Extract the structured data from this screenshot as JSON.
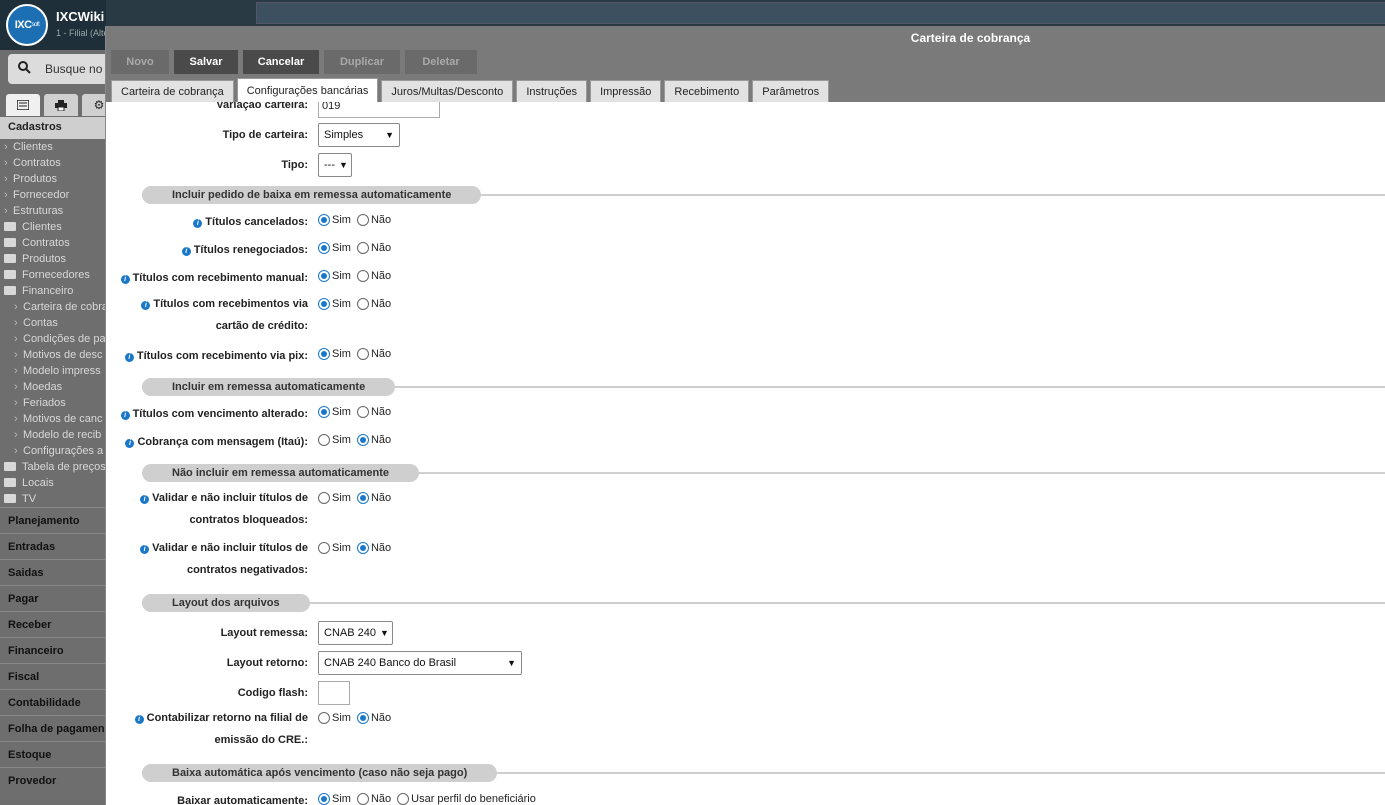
{
  "app": {
    "name": "IXCWiki",
    "subtitle": "1 - Filial (Alte",
    "logo_text": "IXC",
    "logo_sub": "soft"
  },
  "sidebar": {
    "search_placeholder": "Busque no",
    "header": "Cadastros",
    "items": [
      {
        "label": "Clientes",
        "kind": "link"
      },
      {
        "label": "Contratos",
        "kind": "link"
      },
      {
        "label": "Produtos",
        "kind": "link"
      },
      {
        "label": "Fornecedor",
        "kind": "link"
      },
      {
        "label": "Estruturas",
        "kind": "link"
      },
      {
        "label": "Clientes",
        "kind": "folder"
      },
      {
        "label": "Contratos",
        "kind": "folder"
      },
      {
        "label": "Produtos",
        "kind": "folder"
      },
      {
        "label": "Fornecedores",
        "kind": "folder"
      },
      {
        "label": "Financeiro",
        "kind": "folder-open"
      },
      {
        "label": "Carteira de cobra",
        "kind": "sub"
      },
      {
        "label": "Contas",
        "kind": "sub"
      },
      {
        "label": "Condições de pa",
        "kind": "sub"
      },
      {
        "label": "Motivos de desc",
        "kind": "sub"
      },
      {
        "label": "Modelo impress",
        "kind": "sub"
      },
      {
        "label": "Moedas",
        "kind": "sub"
      },
      {
        "label": "Feriados",
        "kind": "sub"
      },
      {
        "label": "Motivos de canc",
        "kind": "sub"
      },
      {
        "label": "Modelo de recib",
        "kind": "sub"
      },
      {
        "label": "Configurações a",
        "kind": "sub"
      },
      {
        "label": "Tabela de preços",
        "kind": "folder"
      },
      {
        "label": "Locais",
        "kind": "folder"
      },
      {
        "label": "TV",
        "kind": "folder"
      }
    ],
    "sections": [
      "Planejamento",
      "Entradas",
      "Saidas",
      "Pagar",
      "Receber",
      "Financeiro",
      "Fiscal",
      "Contabilidade",
      "Folha de pagamen",
      "Estoque",
      "Provedor"
    ]
  },
  "modal": {
    "title": "Carteira de cobrança",
    "toolbar": [
      {
        "label": "Novo",
        "enabled": false
      },
      {
        "label": "Salvar",
        "enabled": true
      },
      {
        "label": "Cancelar",
        "enabled": true
      },
      {
        "label": "Duplicar",
        "enabled": false
      },
      {
        "label": "Deletar",
        "enabled": false
      }
    ],
    "tabs": [
      "Carteira de cobrança",
      "Configurações bancárias",
      "Juros/Multas/Desconto",
      "Instruções",
      "Impressão",
      "Recebimento",
      "Parâmetros"
    ],
    "active_tab": 1
  },
  "form": {
    "variacao": {
      "label": "Variação carteira:",
      "value": "019"
    },
    "tipo_carteira": {
      "label": "Tipo de carteira:",
      "value": "Simples"
    },
    "tipo": {
      "label": "Tipo:",
      "value": "---"
    },
    "sim": "Sim",
    "nao": "Não",
    "sections": {
      "baixa": "Incluir pedido de baixa em remessa automaticamente",
      "incluir": "Incluir em remessa automaticamente",
      "nao_incluir": "Não incluir em remessa automaticamente",
      "layout": "Layout dos arquivos",
      "baixa_auto": "Baixa automática após vencimento (caso não seja pago)"
    },
    "radios": {
      "cancelados": {
        "label": "Títulos cancelados:",
        "value": "Sim"
      },
      "renegociados": {
        "label": "Títulos renegociados:",
        "value": "Sim"
      },
      "manual": {
        "label": "Títulos com recebimento manual:",
        "value": "Sim"
      },
      "cartao_l1": "Títulos com recebimentos via",
      "cartao_l2": "cartão de crédito:",
      "cartao_value": "Sim",
      "pix": {
        "label": "Títulos com recebimento via pix:",
        "value": "Sim"
      },
      "vencimento": {
        "label": "Títulos com vencimento alterado:",
        "value": "Sim"
      },
      "itau": {
        "label": "Cobrança com mensagem (Itaú):",
        "value": "Não"
      },
      "bloq_l1": "Validar e não incluir títulos de",
      "bloq_l2": "contratos bloqueados:",
      "bloq_value": "Não",
      "neg_l1": "Validar e não incluir títulos de",
      "neg_l2": "contratos negativados:",
      "neg_value": "Não",
      "filial_l1": "Contabilizar retorno na filial de",
      "filial_l2": "emissão do CRE.:",
      "filial_value": "Não",
      "baixar": {
        "label": "Baixar automaticamente:",
        "value": "Sim",
        "extra": "Usar perfil do beneficiário"
      }
    },
    "layout_remessa": {
      "label": "Layout remessa:",
      "value": "CNAB 240"
    },
    "layout_retorno": {
      "label": "Layout retorno:",
      "value": "CNAB 240 Banco do Brasil"
    },
    "codigo_flash": {
      "label": "Codigo flash:",
      "value": ""
    }
  },
  "colors": {
    "accent": "#1b78c8",
    "toolbar": "#7a7a7a",
    "sidebar": "#6e6e6e"
  }
}
